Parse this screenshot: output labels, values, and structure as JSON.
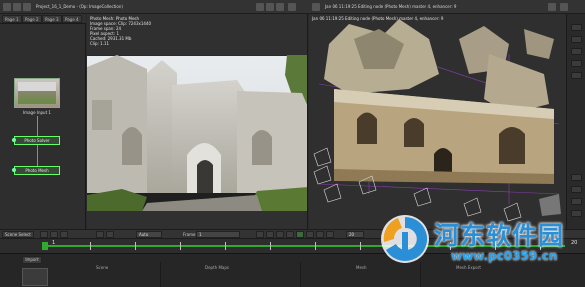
{
  "toolbar": {
    "title_left": "Project_16_1_Demo - (Op: ImageCollection)",
    "title_right": "Jan 06 11:19:25 Editing node (Photo Mesh) master 4, enhancer: 9"
  },
  "tabs": [
    "Page 1",
    "Page 2",
    "Page 3",
    "Page 4"
  ],
  "nodes": {
    "image_input": "Image Input 1",
    "photo_solver": "Photo Solver",
    "photo_mesh": "Photo Mesh"
  },
  "viewer_left": {
    "info": [
      "Photo Mesh: Photo Mesh",
      "Image space: Clip: 7243x1440",
      "Frame span: 24",
      "Pixel aspect: 1",
      "Cached: 2931.31 Mb",
      "Clip: 1.11"
    ]
  },
  "controls": {
    "scene_button": "Scene Select",
    "frame_label": "Frame",
    "mode_select": "Auto",
    "frame_value": "1",
    "end_value": "20"
  },
  "timeline": {
    "start": "1",
    "end": "20"
  },
  "bottom": {
    "button": "Import",
    "headers": [
      "Scene",
      "Depth Maps",
      "Mesh",
      "Mesh Export"
    ]
  },
  "watermark": {
    "name": "河东软件园",
    "url": "www.pc0359.cn"
  },
  "colors": {
    "accent_green": "#2faa2f",
    "watermark_blue": "#2a8fd6"
  }
}
